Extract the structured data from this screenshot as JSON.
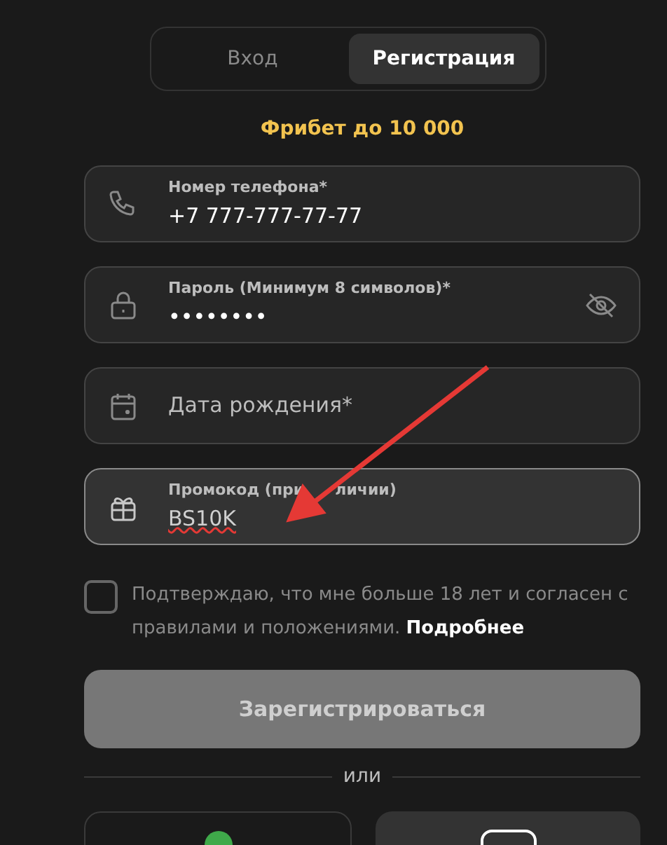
{
  "tabs": [
    {
      "label": "Вход",
      "selected": false
    },
    {
      "label": "Регистрация",
      "selected": true
    }
  ],
  "bonus": "Фрибет до 10 000",
  "fields": [
    {
      "kind": "phone",
      "label": "Номер телефона*",
      "value": "+7 777-777-77-77",
      "active": false
    },
    {
      "kind": "password",
      "label": "Пароль (Минимум 8 символов)*",
      "value": "••••••••",
      "active": false
    },
    {
      "kind": "date",
      "placeholder": "Дата рождения*",
      "active": false
    },
    {
      "kind": "promo",
      "label_parts": [
        "Промокод (при",
        "личии)"
      ],
      "value": "BS10K",
      "active": true,
      "misspelled": true
    }
  ],
  "consent": {
    "checked": false,
    "text": "Подтверждаю, что мне больше 18 лет и согласен с правилами и положениями.",
    "link": "Подробнее"
  },
  "submit": {
    "label": "Зарегистрироваться",
    "disabled": true
  },
  "divider": "или"
}
